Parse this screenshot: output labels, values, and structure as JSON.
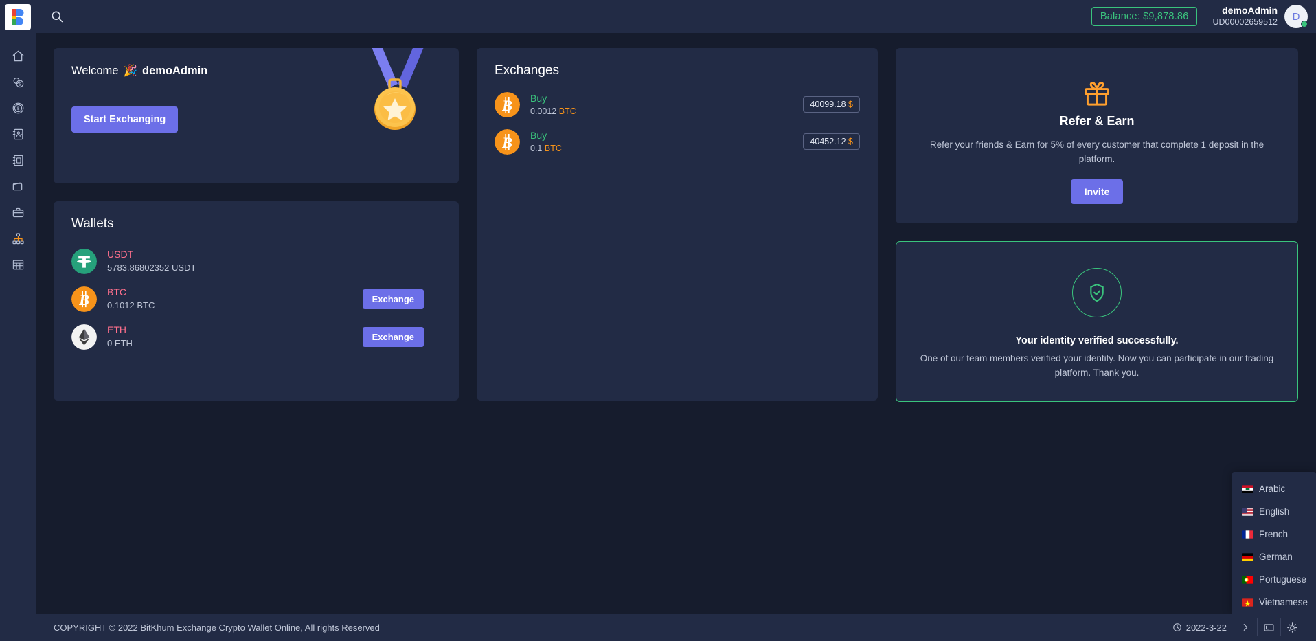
{
  "brand": {
    "logo_letter": "B",
    "name": "BitKhum"
  },
  "header": {
    "search_icon": "search-icon",
    "balance_label": "Balance: $9,878.86",
    "user_name": "demoAdmin",
    "user_id": "UD00002659512",
    "avatar_initial": "D",
    "status": "online"
  },
  "sidebar": {
    "items": [
      {
        "icon": "home-icon",
        "label": "Dashboard"
      },
      {
        "icon": "coins-icon",
        "label": "Coins"
      },
      {
        "icon": "dollar-circle-icon",
        "label": "Deposits"
      },
      {
        "icon": "contact-card-icon",
        "label": "KYC"
      },
      {
        "icon": "address-book-icon",
        "label": "Accounts"
      },
      {
        "icon": "wallet-icon",
        "label": "Wallets"
      },
      {
        "icon": "briefcase-icon",
        "label": "Portfolio"
      },
      {
        "icon": "sitemap-icon",
        "label": "Referrals"
      },
      {
        "icon": "table-icon",
        "label": "Reports"
      }
    ]
  },
  "welcome": {
    "greeting_prefix": "Welcome",
    "emoji": "🎉",
    "user": "demoAdmin",
    "cta_label": "Start Exchanging",
    "illustration": "medal-illustration"
  },
  "wallets": {
    "title": "Wallets",
    "rows": [
      {
        "symbol": "USDT",
        "amount": "5783.86802352 USDT",
        "icon": "usdt-icon",
        "action": null
      },
      {
        "symbol": "BTC",
        "amount": "0.1012 BTC",
        "icon": "btc-icon",
        "action": "Exchange"
      },
      {
        "symbol": "ETH",
        "amount": "0 ETH",
        "icon": "eth-icon",
        "action": "Exchange"
      }
    ]
  },
  "exchanges": {
    "title": "Exchanges",
    "rows": [
      {
        "side": "Buy",
        "amount": "0.0012",
        "unit": "BTC",
        "price": "40099.18",
        "currency": "$",
        "icon": "btc-icon"
      },
      {
        "side": "Buy",
        "amount": "0.1",
        "unit": "BTC",
        "price": "40452.12",
        "currency": "$",
        "icon": "btc-icon"
      }
    ]
  },
  "refer": {
    "icon": "gift-icon",
    "title": "Refer & Earn",
    "description": "Refer your friends & Earn for 5% of every customer that complete 1 deposit in the platform.",
    "button_label": "Invite"
  },
  "verified": {
    "icon": "shield-check-icon",
    "title": "Your identity verified successfully.",
    "description": "One of our team members verified your identity. Now you can participate in our trading platform. Thank you."
  },
  "language_menu": {
    "items": [
      {
        "label": "Arabic",
        "flag": "flag-iraq"
      },
      {
        "label": "English",
        "flag": "flag-usa"
      },
      {
        "label": "French",
        "flag": "flag-france"
      },
      {
        "label": "German",
        "flag": "flag-germany"
      },
      {
        "label": "Portuguese",
        "flag": "flag-portugal"
      },
      {
        "label": "Vietnamese",
        "flag": "flag-vietnam"
      }
    ]
  },
  "footer": {
    "copyright": "COPYRIGHT © 2022 BitKhum Exchange Crypto Wallet Online, All rights Reserved",
    "date": "2022-3-22",
    "clock_icon": "clock-icon",
    "chevron_icon": "chevron-right-icon",
    "fullscreen_icon": "fullscreen-icon",
    "brightness_icon": "brightness-icon"
  },
  "colors": {
    "page_bg": "#161c2d",
    "panel_bg": "#222b45",
    "accent_purple": "#6c6fe8",
    "accent_green": "#3ac47d",
    "accent_orange": "#f7931a",
    "coin_red": "#ff708d"
  }
}
